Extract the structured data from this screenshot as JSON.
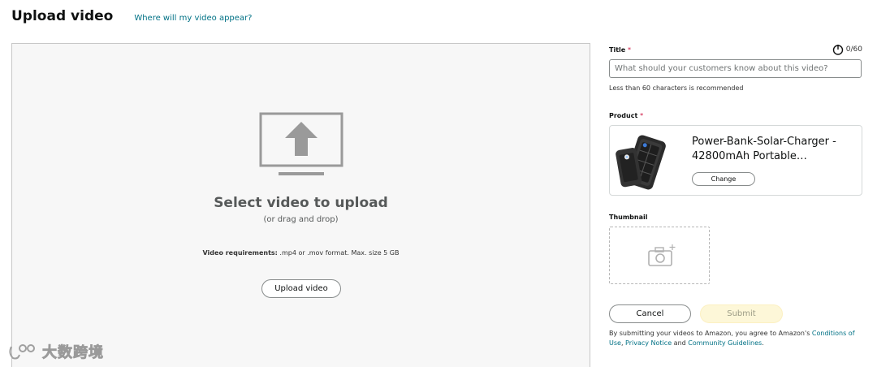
{
  "header": {
    "title": "Upload video",
    "help_link": "Where will my video appear?"
  },
  "dropzone": {
    "title": "Select video to upload",
    "subtitle": "(or drag and drop)",
    "requirements_label": "Video requirements:",
    "requirements_text": " .mp4 or .mov format. Max. size 5 GB",
    "upload_button": "Upload video"
  },
  "form": {
    "title_label": "Title",
    "required_mark": "*",
    "title_counter": "0/60",
    "title_value": "",
    "title_placeholder": "What should your customers know about this video?",
    "title_hint": "Less than 60 characters is recommended",
    "product_label": "Product",
    "product_name": "Power-Bank-Solar-Charger - 42800mAh Portable…",
    "change_button": "Change",
    "thumbnail_label": "Thumbnail",
    "cancel_button": "Cancel",
    "submit_button": "Submit",
    "terms_prefix": "By submitting your videos to Amazon, you agree to Amazon's ",
    "terms_link_1": "Conditions of Use",
    "terms_sep_1": ", ",
    "terms_link_2": "Privacy Notice",
    "terms_sep_2": " and ",
    "terms_link_3": "Community Guidelines",
    "terms_end": "."
  },
  "watermark": {
    "text": "大数跨境"
  },
  "colors": {
    "link": "#007185",
    "required": "#cc0c39",
    "submit_disabled_bg": "#fdf7d8",
    "dropzone_bg": "#f7f7f7"
  },
  "icons": {
    "upload": "monitor-upload-icon",
    "counter": "power-circle-icon",
    "thumbnail": "camera-plus-icon"
  }
}
